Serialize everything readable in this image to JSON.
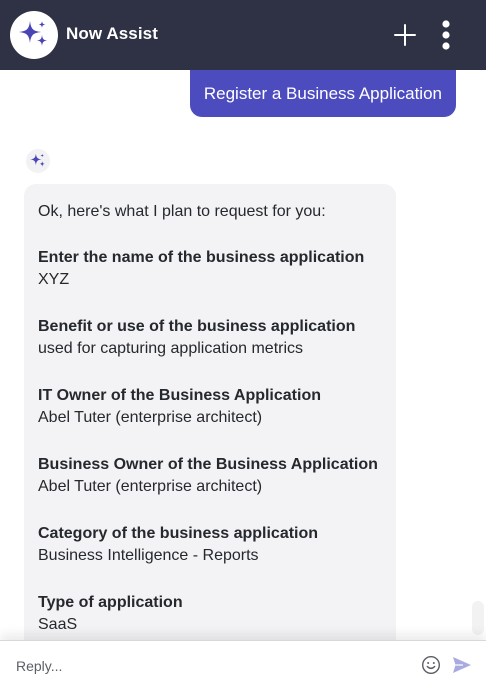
{
  "header": {
    "title": "Now Assist",
    "avatar_icon": "sparkle-icon",
    "new_chat_icon": "plus-icon",
    "menu_icon": "more-vertical-icon"
  },
  "chat": {
    "user_message": "Register a Business Application",
    "assistant": {
      "icon": "sparkle-icon",
      "intro": "Ok, here's what I plan to request for you:",
      "fields": [
        {
          "label": "Enter the name of the business application",
          "value": "XYZ"
        },
        {
          "label": "Benefit or use of the business application",
          "value": "used for capturing application metrics"
        },
        {
          "label": "IT Owner of the Business Application",
          "value": "Abel Tuter (enterprise architect)"
        },
        {
          "label": "Business Owner of the Business Application",
          "value": "Abel Tuter (enterprise architect)"
        },
        {
          "label": "Category of the business application",
          "value": "Business Intelligence - Reports"
        },
        {
          "label": "Type of application",
          "value": "SaaS"
        }
      ]
    }
  },
  "composer": {
    "placeholder": "Reply...",
    "value": "",
    "emoji_icon": "emoji-icon",
    "send_icon": "send-icon"
  },
  "colors": {
    "header_bg": "#2f3145",
    "accent": "#4d4cbf",
    "sparkle": "#4a45b5",
    "bubble_bg": "#f3f3f5"
  }
}
